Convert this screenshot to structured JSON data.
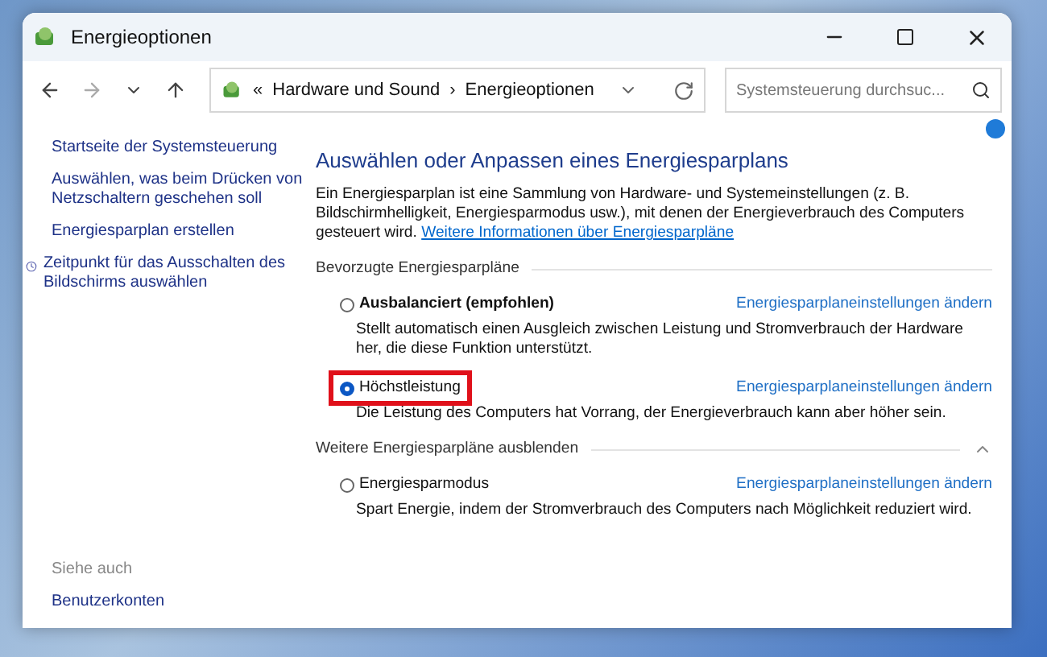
{
  "window": {
    "title": "Energieoptionen"
  },
  "address": {
    "overflow": "«",
    "crumbs": [
      "Hardware und Sound",
      "Energieoptionen"
    ],
    "separator": "›"
  },
  "search": {
    "placeholder": "Systemsteuerung durchsuc..."
  },
  "sidebar": {
    "links": [
      {
        "label": "Startseite der Systemsteuerung",
        "kind": "plain"
      },
      {
        "label": "Auswählen, was beim Drücken von Netzschaltern geschehen soll",
        "kind": "plain"
      },
      {
        "label": "Energiesparplan erstellen",
        "kind": "plain"
      },
      {
        "label": "Zeitpunkt für das Ausschalten des Bildschirms auswählen",
        "kind": "icon"
      }
    ],
    "see_also": {
      "heading": "Siehe auch",
      "links": [
        "Benutzerkonten"
      ]
    }
  },
  "main": {
    "heading": "Auswählen oder Anpassen eines Energiesparplans",
    "intro": "Ein Energiesparplan ist eine Sammlung von Hardware- und Systemeinstellungen (z. B. Bildschirmhelligkeit, Energiesparmodus usw.), mit denen der Energieverbrauch des Computers gesteuert wird.",
    "intro_link": "Weitere Informationen über Energiesparpläne",
    "groups": [
      {
        "title": "Bevorzugte Energiesparpläne",
        "collapse_toggle": false,
        "plans": [
          {
            "name": "Ausbalanciert (empfohlen)",
            "selected": false,
            "highlighted": false,
            "link": "Energiesparplaneinstellungen ändern",
            "description": "Stellt automatisch einen Ausgleich zwischen Leistung und Stromverbrauch der Hardware her, die diese Funktion unterstützt."
          },
          {
            "name": "Höchstleistung",
            "selected": true,
            "highlighted": true,
            "link": "Energiesparplaneinstellungen ändern",
            "description": "Die Leistung des Computers hat Vorrang, der Energieverbrauch kann aber höher sein."
          }
        ]
      },
      {
        "title": "Weitere Energiesparpläne ausblenden",
        "collapse_toggle": true,
        "plans": [
          {
            "name": "Energiesparmodus",
            "selected": false,
            "highlighted": false,
            "link": "Energiesparplaneinstellungen ändern",
            "description": "Spart Energie, indem der Stromverbrauch des Computers nach Möglichkeit reduziert wird."
          }
        ]
      }
    ]
  }
}
